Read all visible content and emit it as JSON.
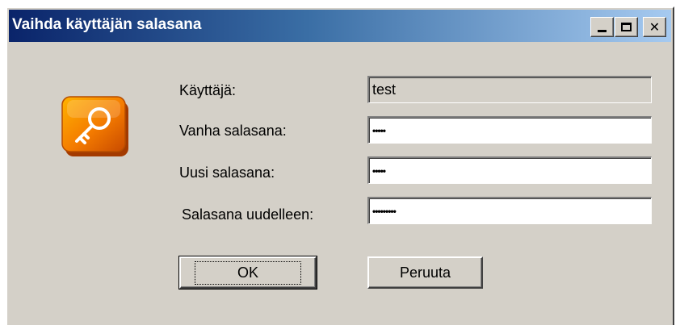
{
  "window": {
    "title": "Vaihda käyttäjän salasana",
    "controls": {
      "minimize": "_",
      "maximize": "□",
      "close": "✕"
    }
  },
  "icon": {
    "name": "key-icon",
    "color": "#f47b00"
  },
  "form": {
    "user_label": "Käyttäjä:",
    "user_value": "test",
    "old_password_label": "Vanha salasana:",
    "old_password_value": "•••••",
    "new_password_label": "Uusi salasana:",
    "new_password_value": "•••••",
    "confirm_password_label": "Salasana uudelleen:",
    "confirm_password_value": "•••••••••"
  },
  "buttons": {
    "ok_label": "OK",
    "cancel_label": "Peruuta"
  }
}
